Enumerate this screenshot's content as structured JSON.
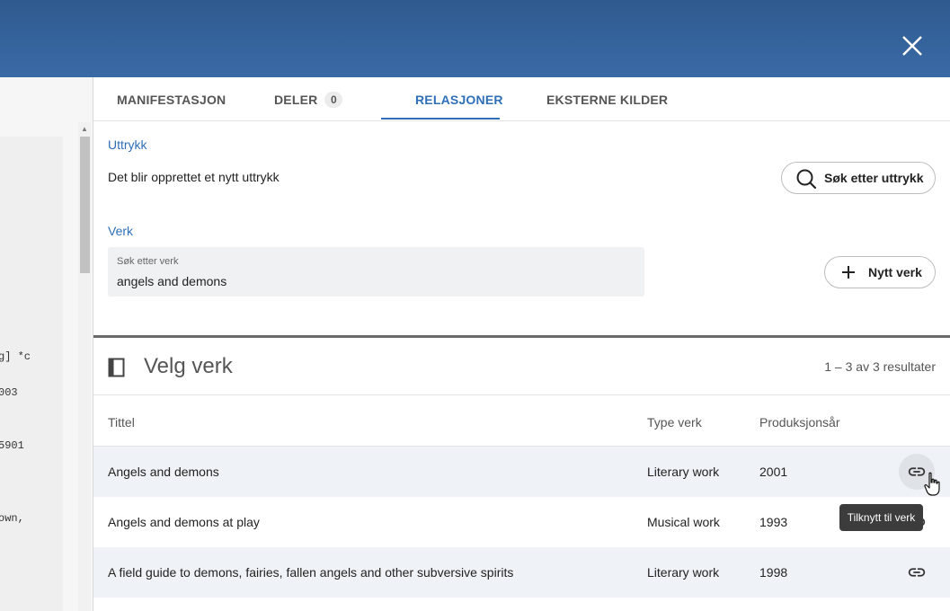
{
  "header": {
    "close_icon": "close-icon"
  },
  "left_panel": {
    "lines": [
      "g] *c",
      "003",
      "5901",
      "own,"
    ]
  },
  "tabs": [
    {
      "label": "MANIFESTASJON"
    },
    {
      "label": "DELER",
      "badge": "0"
    },
    {
      "label": "RELASJONER",
      "active": true
    },
    {
      "label": "EKSTERNE KILDER"
    }
  ],
  "expression": {
    "label": "Uttrykk",
    "text": "Det blir opprettet et nytt uttrykk",
    "search_button": "Søk etter uttrykk"
  },
  "work": {
    "label": "Verk",
    "search_label": "Søk etter verk",
    "search_value": "angels and demons",
    "new_button": "Nytt verk"
  },
  "results": {
    "title": "Velg verk",
    "count": "1 – 3 av 3 resultater",
    "columns": {
      "title": "Tittel",
      "type": "Type verk",
      "year": "Produksjonsår"
    },
    "rows": [
      {
        "title": "Angels and demons",
        "type": "Literary work",
        "year": "2001"
      },
      {
        "title": "Angels and demons at play",
        "type": "Musical work",
        "year": "1993"
      },
      {
        "title": "A field guide to demons, fairies, fallen angels and other subversive spirits",
        "type": "Literary work",
        "year": "1998"
      }
    ],
    "tooltip": "Tilknytt til verk"
  },
  "colors": {
    "accent": "#2f6fb8",
    "header": "#34629b"
  }
}
